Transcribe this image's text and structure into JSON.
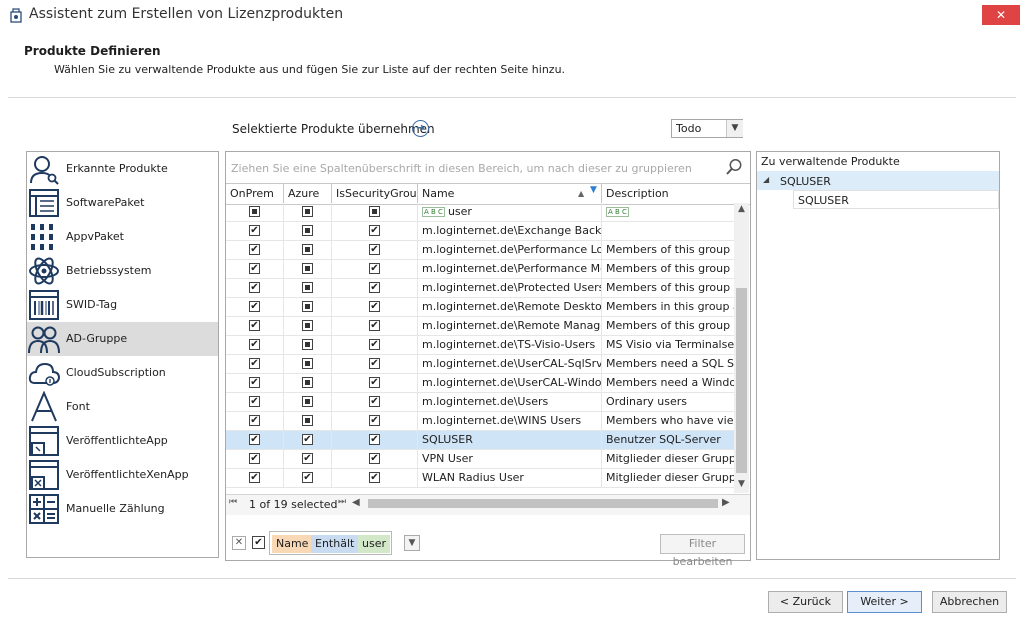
{
  "window": {
    "title": "Assistent zum Erstellen von Lizenzprodukten",
    "close_glyph": "✕"
  },
  "header": {
    "title": "Produkte Definieren",
    "subtitle": "Wählen Sie zu verwaltende Produkte aus und fügen Sie zur Liste auf der rechten Seite hinzu."
  },
  "toolbar": {
    "apply_label": "Selektierte Produkte übernehmen",
    "dropdown_value": "Todo"
  },
  "product_types": [
    {
      "label": "Erkannte Produkte",
      "icon": "person-search-icon",
      "selected": false
    },
    {
      "label": "SoftwarePaket",
      "icon": "package-icon",
      "selected": false
    },
    {
      "label": "AppvPaket",
      "icon": "appv-grid-icon",
      "selected": false
    },
    {
      "label": "Betriebssystem",
      "icon": "atom-icon",
      "selected": false
    },
    {
      "label": "SWID-Tag",
      "icon": "barcode-icon",
      "selected": false
    },
    {
      "label": "AD-Gruppe",
      "icon": "group-icon",
      "selected": true
    },
    {
      "label": "CloudSubscription",
      "icon": "cloud-icon",
      "selected": false
    },
    {
      "label": "Font",
      "icon": "font-icon",
      "selected": false
    },
    {
      "label": "VeröffentlichteApp",
      "icon": "published-app-icon",
      "selected": false
    },
    {
      "label": "VeröffentlichteXenApp",
      "icon": "published-xenapp-icon",
      "selected": false
    },
    {
      "label": "Manuelle Zählung",
      "icon": "calculator-icon",
      "selected": false
    }
  ],
  "grid": {
    "group_hint": "Ziehen Sie eine Spaltenüberschrift in diesen Bereich, um nach dieser zu gruppieren",
    "columns": [
      "OnPrem",
      "Azure",
      "IsSecurityGroup",
      "Name",
      "Description"
    ],
    "filter_row": {
      "name": "user",
      "description": ""
    },
    "rows": [
      {
        "onprem": true,
        "azure": false,
        "sec": true,
        "name": "m.loginternet.de\\Exchange Backup...",
        "desc": "",
        "selected": false
      },
      {
        "onprem": true,
        "azure": false,
        "sec": true,
        "name": "m.loginternet.de\\Performance Log ...",
        "desc": "Members of this group hav",
        "selected": false
      },
      {
        "onprem": true,
        "azure": false,
        "sec": true,
        "name": "m.loginternet.de\\Performance Mon...",
        "desc": "Members of this group hav",
        "selected": false
      },
      {
        "onprem": true,
        "azure": false,
        "sec": true,
        "name": "m.loginternet.de\\Protected Users",
        "desc": "Members of this group are",
        "selected": false
      },
      {
        "onprem": true,
        "azure": false,
        "sec": true,
        "name": "m.loginternet.de\\Remote Desktop ...",
        "desc": "Members in this group are",
        "selected": false
      },
      {
        "onprem": true,
        "azure": false,
        "sec": true,
        "name": "m.loginternet.de\\Remote Manage...",
        "desc": "Members of this group can",
        "selected": false
      },
      {
        "onprem": true,
        "azure": false,
        "sec": true,
        "name": "m.loginternet.de\\TS-Visio-Users",
        "desc": "MS Visio via Terminalserver",
        "selected": false
      },
      {
        "onprem": true,
        "azure": false,
        "sec": true,
        "name": "m.loginternet.de\\UserCAL-SqlSrv",
        "desc": "Members need a SQL Serve",
        "selected": false
      },
      {
        "onprem": true,
        "azure": false,
        "sec": true,
        "name": "m.loginternet.de\\UserCAL-Window...",
        "desc": "Members need a Windows",
        "selected": false
      },
      {
        "onprem": true,
        "azure": false,
        "sec": true,
        "name": "m.loginternet.de\\Users",
        "desc": "Ordinary users",
        "selected": false
      },
      {
        "onprem": true,
        "azure": false,
        "sec": true,
        "name": "m.loginternet.de\\WINS Users",
        "desc": "Members who have view-o",
        "selected": false
      },
      {
        "onprem": true,
        "azure": true,
        "sec": true,
        "name": "SQLUSER",
        "desc": "Benutzer SQL-Server",
        "selected": true
      },
      {
        "onprem": true,
        "azure": true,
        "sec": true,
        "name": "VPN User",
        "desc": "Mitglieder dieser Gruppe d",
        "selected": false
      },
      {
        "onprem": true,
        "azure": true,
        "sec": true,
        "name": "WLAN Radius User",
        "desc": "Mitglieder dieser Gruppe d",
        "selected": false
      }
    ],
    "status": "1 of 19 selected"
  },
  "filter": {
    "field": "Name",
    "operator": "Enthält",
    "value": "user",
    "edit_label": "Filter bearbeiten"
  },
  "target": {
    "title": "Zu verwaltende Produkte",
    "root": "SQLUSER",
    "child": "SQLUSER"
  },
  "footer": {
    "back": "< Zurück",
    "next": "Weiter >",
    "cancel": "Abbrechen"
  }
}
